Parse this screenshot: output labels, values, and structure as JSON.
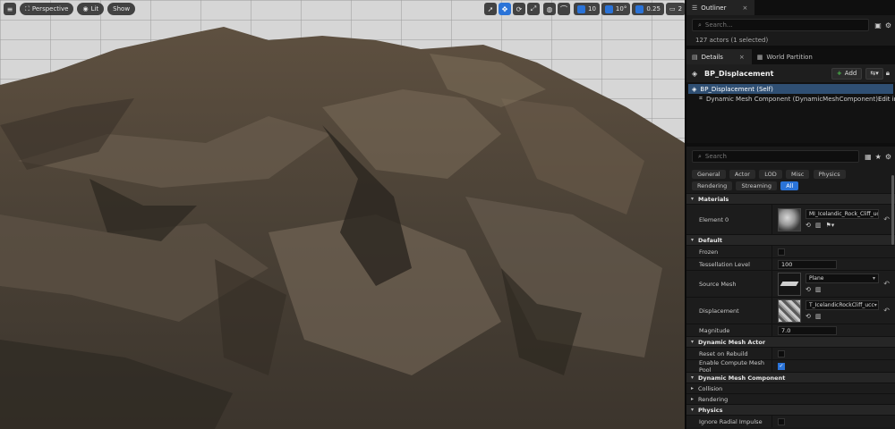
{
  "viewport": {
    "perspective_label": "Perspective",
    "lit_label": "Lit",
    "show_label": "Show",
    "grid_snap_value": "10",
    "rotation_snap_value": "10°",
    "scale_snap_value": "0.25",
    "camera_speed_value": "2"
  },
  "outliner": {
    "tab_label": "Outliner",
    "search_placeholder": "Search...",
    "actor_count": "127 actors (1 selected)"
  },
  "details": {
    "tab_details": "Details",
    "tab_world_partition": "World Partition",
    "actor_name": "BP_Displacement",
    "add_label": "Add",
    "tree": {
      "self_item": "BP_Displacement (Self)",
      "component_item": "Dynamic Mesh Component (DynamicMeshComponent)",
      "edit_link": "Edit in C++"
    },
    "search_placeholder": "Search",
    "filters": [
      "General",
      "Actor",
      "LOD",
      "Misc",
      "Physics",
      "Rendering",
      "Streaming",
      "All"
    ],
    "sections": {
      "materials": "Materials",
      "element0_label": "Element 0",
      "element0_value": "MI_Icelandic_Rock_Cliff_ucdm",
      "default": "Default",
      "frozen_label": "Frozen",
      "tess_label": "Tessellation Level",
      "tess_value": "100",
      "source_mesh_label": "Source Mesh",
      "source_mesh_value": "Plane",
      "displacement_label": "Displacement",
      "displacement_value": "T_IcelandicRockCliff_ucc",
      "magnitude_label": "Magnitude",
      "magnitude_value": "7.0",
      "dma": "Dynamic Mesh Actor",
      "reset_rebuild_label": "Reset on Rebuild",
      "compute_pool_label": "Enable Compute Mesh Pool",
      "dmc": "Dynamic Mesh Component",
      "collision": "Collision",
      "rendering": "Rendering",
      "physics": "Physics",
      "ignore_radial_label": "Ignore Radial Impulse"
    }
  },
  "colors": {
    "accent": "#2a73d8",
    "selection": "#2f4f73",
    "panel_bg": "#1a1a1a"
  }
}
